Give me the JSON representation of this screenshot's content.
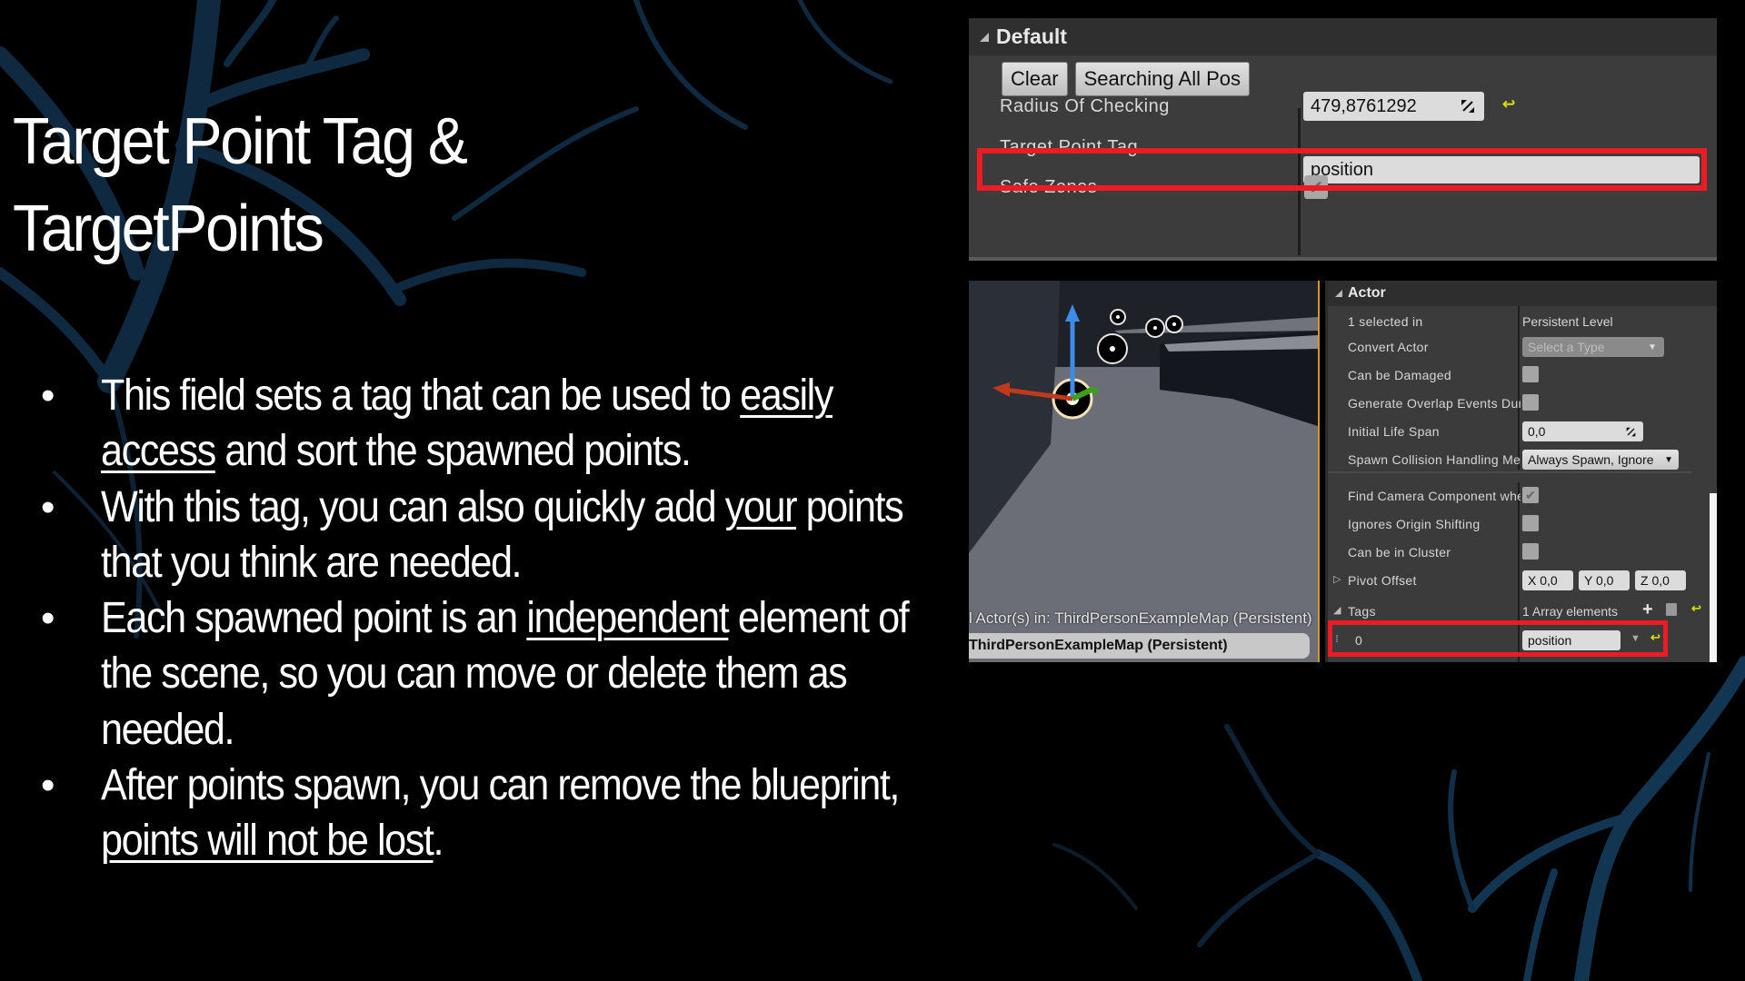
{
  "slide": {
    "title_line1": "Target Point Tag &",
    "title_line2": "TargetPoints",
    "bullets": [
      {
        "segments": [
          {
            "text": "This field sets a tag that can be used to ",
            "u": false
          },
          {
            "text": "easily access",
            "u": true
          },
          {
            "text": " and sort the spawned points.",
            "u": false
          }
        ]
      },
      {
        "segments": [
          {
            "text": "With this tag, you can also quickly add ",
            "u": false
          },
          {
            "text": "your",
            "u": true
          },
          {
            "text": " points that you think are needed.",
            "u": false
          }
        ]
      },
      {
        "segments": [
          {
            "text": "Each spawned point is an ",
            "u": false
          },
          {
            "text": "independent",
            "u": true
          },
          {
            "text": " element of the scene, so you can move or delete them as needed.",
            "u": false
          }
        ]
      },
      {
        "segments": [
          {
            "text": "After points spawn, you can remove the blueprint, ",
            "u": false
          },
          {
            "text": "points will not be lost",
            "u": true
          },
          {
            "text": ".",
            "u": false
          }
        ]
      }
    ],
    "bullet_glyph": "•"
  },
  "default_panel": {
    "header": "Default",
    "buttons": {
      "clear": "Clear",
      "search": "Searching All Pos"
    },
    "rows": {
      "radius_label": "Radius Of Checking",
      "radius_value": "479,8761292",
      "tag_label": "Target Point Tag",
      "tag_value": "position",
      "safe_zones_label": "Safe Zones",
      "safe_zones_checked": true
    },
    "icons": {
      "reset": "reset-to-default-icon",
      "spin": "spin-drag-icon",
      "check": "✔"
    }
  },
  "viewport": {
    "status_text": "l Actor(s) in:  ThirdPersonExampleMap (Persistent)",
    "level_text": "ThirdPersonExampleMap (Persistent)"
  },
  "actor_panel": {
    "header": "Actor",
    "rows": {
      "selected_label": "1 selected in",
      "selected_value": "Persistent Level",
      "convert_label": "Convert Actor",
      "convert_value": "Select a Type",
      "damaged_label": "Can be Damaged",
      "damaged_checked": false,
      "overlap_label": "Generate Overlap Events During Level Streaming",
      "overlap_checked": false,
      "lifespan_label": "Initial Life Span",
      "lifespan_value": "0,0",
      "spawn_label": "Spawn Collision Handling Method",
      "spawn_value": "Always Spawn, Ignore",
      "camera_label": "Find Camera Component when ViewTarget",
      "camera_checked": true,
      "origin_label": "Ignores Origin Shifting",
      "origin_checked": false,
      "cluster_label": "Can be in Cluster",
      "cluster_checked": false,
      "pivot_label": "Pivot Offset",
      "pivot_x": "X  0,0",
      "pivot_y": "Y  0,0",
      "pivot_z": "Z  0,0",
      "tags_label": "Tags",
      "tags_count": "1 Array elements",
      "tag_index": "0",
      "tag_value": "position"
    },
    "icons": {
      "add": "+",
      "delete": "trash-icon",
      "reset": "reset-to-default-icon"
    }
  },
  "colors": {
    "highlight": "#ed1c24",
    "reset_icon": "#d8d800",
    "branch": "#0f2a40"
  }
}
